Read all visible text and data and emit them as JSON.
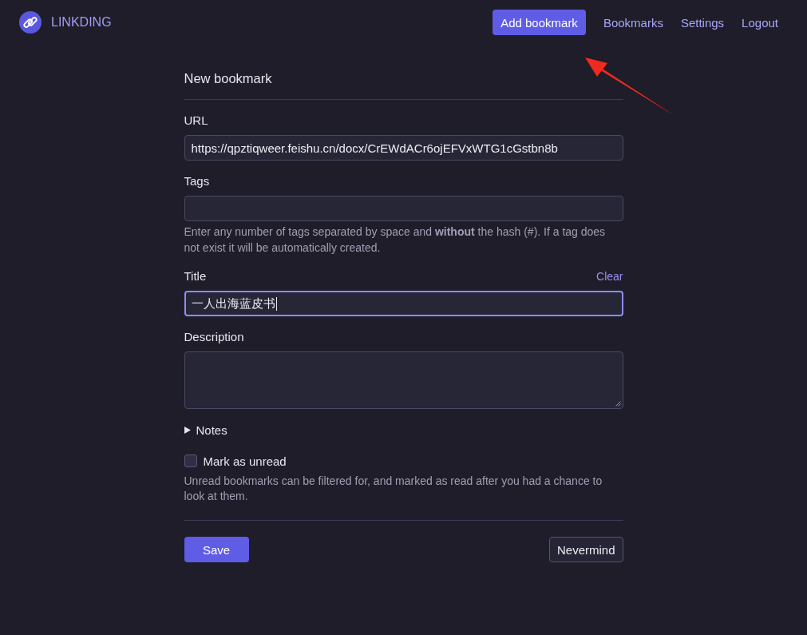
{
  "brand": {
    "name": "LINKDING"
  },
  "nav": [
    {
      "label": "Add bookmark",
      "kind": "primary"
    },
    {
      "label": "Bookmarks",
      "kind": "link"
    },
    {
      "label": "Settings",
      "kind": "link"
    },
    {
      "label": "Logout",
      "kind": "link"
    }
  ],
  "form": {
    "title": "New bookmark",
    "fields": [
      {
        "kind": "input",
        "label": "URL",
        "value": "https://qpztiqweer.feishu.cn/docx/CrEWdACr6ojEFVxWTG1cGstbn8b",
        "focused": false
      },
      {
        "kind": "input",
        "label": "Tags",
        "focused": false,
        "hint": "Enter any number of tags separated by space and **without** the hash (#). If a tag does not exist it will be automatically created."
      },
      {
        "kind": "input",
        "label": "Title",
        "value": "一人出海蓝皮书",
        "focused": true,
        "action": "Clear"
      },
      {
        "kind": "textarea",
        "label": "Description",
        "focused": false
      }
    ],
    "notes": {
      "label": "Notes",
      "expanded": false
    },
    "unread": {
      "label": "Mark as unread",
      "checked": false,
      "hint": "Unread bookmarks can be filtered for, and marked as read after you had a chance to look at them."
    },
    "buttons": [
      {
        "label": "Save",
        "kind": "primary"
      },
      {
        "label": "Nevermind",
        "kind": "secondary"
      }
    ]
  },
  "annotations": [
    {
      "kind": "arrow"
    }
  ]
}
